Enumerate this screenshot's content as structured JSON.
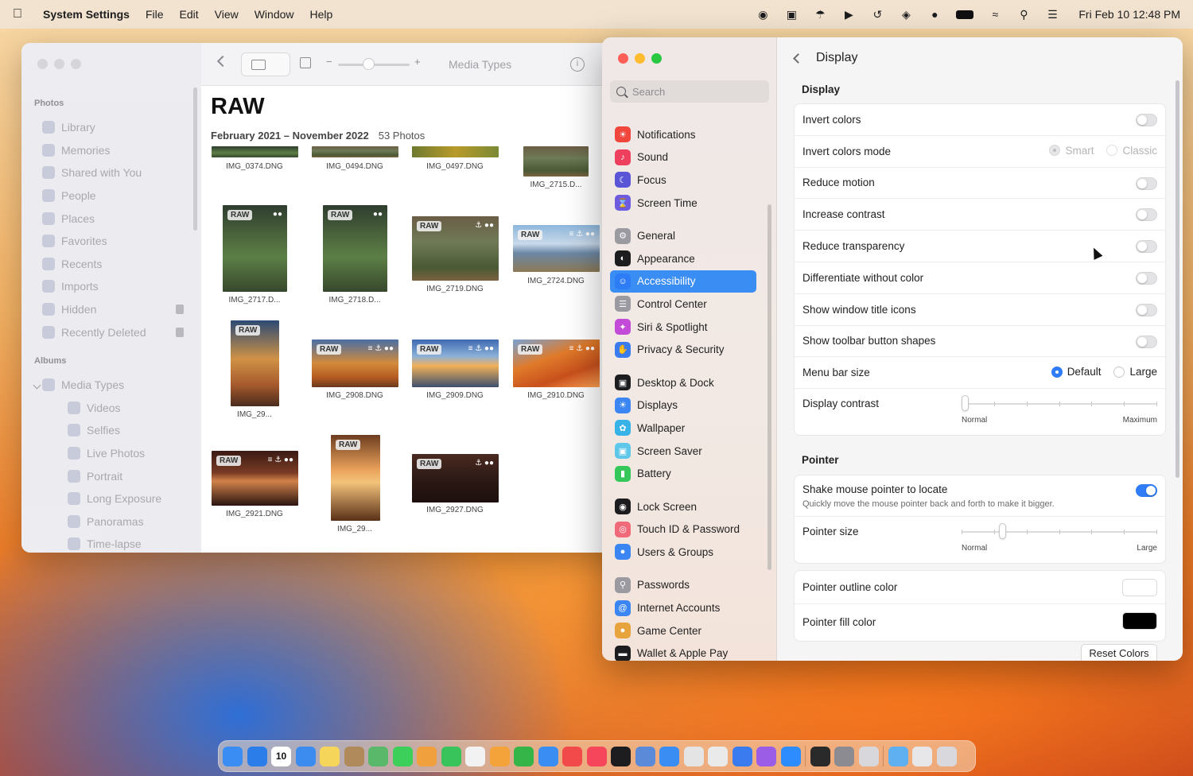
{
  "menubar": {
    "app_name": "System Settings",
    "menus": [
      "File",
      "Edit",
      "View",
      "Window",
      "Help"
    ],
    "clock": "Fri Feb 10  12:48 PM"
  },
  "photos": {
    "toolbar_title": "Media Types",
    "info_glyph": "i",
    "title": "RAW",
    "date_range": "February 2021 – November 2022",
    "count": "53 Photos",
    "sidebar": {
      "section_photos": "Photos",
      "items": [
        "Library",
        "Memories",
        "Shared with You",
        "People",
        "Places",
        "Favorites",
        "Recents",
        "Imports",
        "Hidden",
        "Recently Deleted"
      ],
      "section_albums": "Albums",
      "albums_parent": "Media Types",
      "album_children": [
        "Videos",
        "Selfies",
        "Live Photos",
        "Portrait",
        "Long Exposure",
        "Panoramas",
        "Time-lapse"
      ]
    },
    "badge": "RAW",
    "thumbs": [
      "IMG_0374.DNG",
      "IMG_0494.DNG",
      "IMG_0497.DNG",
      "IMG_2715.D...",
      "IMG_2717.D...",
      "IMG_2718.D...",
      "IMG_2719.DNG",
      "IMG_2724.DNG",
      "IMG_29...",
      "IMG_2908.DNG",
      "IMG_2909.DNG",
      "IMG_2910.DNG",
      "IMG_2921.DNG",
      "IMG_29...",
      "IMG_2927.DNG"
    ]
  },
  "settings": {
    "search_placeholder": "Search",
    "sidebar_items": [
      {
        "label": "Notifications",
        "color": "#f0463c",
        "icon": "bell-icon"
      },
      {
        "label": "Sound",
        "color": "#ee3f5f",
        "icon": "speaker-icon"
      },
      {
        "label": "Focus",
        "color": "#5a55d6",
        "icon": "moon-icon"
      },
      {
        "label": "Screen Time",
        "color": "#6d5be0",
        "icon": "hourglass-icon"
      },
      {
        "label": "General",
        "color": "#9a9aa0",
        "icon": "gear-icon"
      },
      {
        "label": "Appearance",
        "color": "#1d1d1f",
        "icon": "appearance-icon"
      },
      {
        "label": "Accessibility",
        "color": "#2d7cf5",
        "icon": "accessibility-icon"
      },
      {
        "label": "Control Center",
        "color": "#9a9aa0",
        "icon": "control-center-icon"
      },
      {
        "label": "Siri & Spotlight",
        "color": "#c24bd8",
        "icon": "siri-icon"
      },
      {
        "label": "Privacy & Security",
        "color": "#3b7bf0",
        "icon": "hand-icon"
      },
      {
        "label": "Desktop & Dock",
        "color": "#1d1d1f",
        "icon": "dock-icon"
      },
      {
        "label": "Displays",
        "color": "#3b86f2",
        "icon": "sun-icon"
      },
      {
        "label": "Wallpaper",
        "color": "#37b3e8",
        "icon": "wallpaper-icon"
      },
      {
        "label": "Screen Saver",
        "color": "#5fc7e9",
        "icon": "screensaver-icon"
      },
      {
        "label": "Battery",
        "color": "#35c75a",
        "icon": "battery-icon"
      },
      {
        "label": "Lock Screen",
        "color": "#1d1d1f",
        "icon": "lock-icon"
      },
      {
        "label": "Touch ID & Password",
        "color": "#f06a7a",
        "icon": "fingerprint-icon"
      },
      {
        "label": "Users & Groups",
        "color": "#3b86f2",
        "icon": "users-icon"
      },
      {
        "label": "Passwords",
        "color": "#9a9aa0",
        "icon": "key-icon"
      },
      {
        "label": "Internet Accounts",
        "color": "#3b86f2",
        "icon": "at-icon"
      },
      {
        "label": "Game Center",
        "color": "#e8a43c",
        "icon": "game-center-icon"
      },
      {
        "label": "Wallet & Apple Pay",
        "color": "#1d1d1f",
        "icon": "wallet-icon"
      }
    ],
    "header_title": "Display",
    "display_section": "Display",
    "rows": {
      "invert_colors": "Invert colors",
      "invert_mode": "Invert colors mode",
      "invert_mode_smart": "Smart",
      "invert_mode_classic": "Classic",
      "reduce_motion": "Reduce motion",
      "increase_contrast": "Increase contrast",
      "reduce_transparency": "Reduce transparency",
      "differentiate": "Differentiate without color",
      "window_title_icons": "Show window title icons",
      "toolbar_shapes": "Show toolbar button shapes",
      "menu_bar_size": "Menu bar size",
      "menu_default": "Default",
      "menu_large": "Large",
      "display_contrast": "Display contrast",
      "contrast_min": "Normal",
      "contrast_max": "Maximum"
    },
    "pointer_section": "Pointer",
    "pointer": {
      "shake": "Shake mouse pointer to locate",
      "shake_sub": "Quickly move the mouse pointer back and forth to make it bigger.",
      "size": "Pointer size",
      "size_min": "Normal",
      "size_max": "Large",
      "outline": "Pointer outline color",
      "outline_color": "#ffffff",
      "fill": "Pointer fill color",
      "fill_color": "#000000",
      "reset": "Reset Colors"
    },
    "states": {
      "invert_colors": false,
      "reduce_motion": false,
      "increase_contrast": false,
      "reduce_transparency": false,
      "differentiate": false,
      "window_title_icons": false,
      "toolbar_shapes": false,
      "shake": true,
      "display_contrast": 0,
      "pointer_size": 0.2
    }
  }
}
